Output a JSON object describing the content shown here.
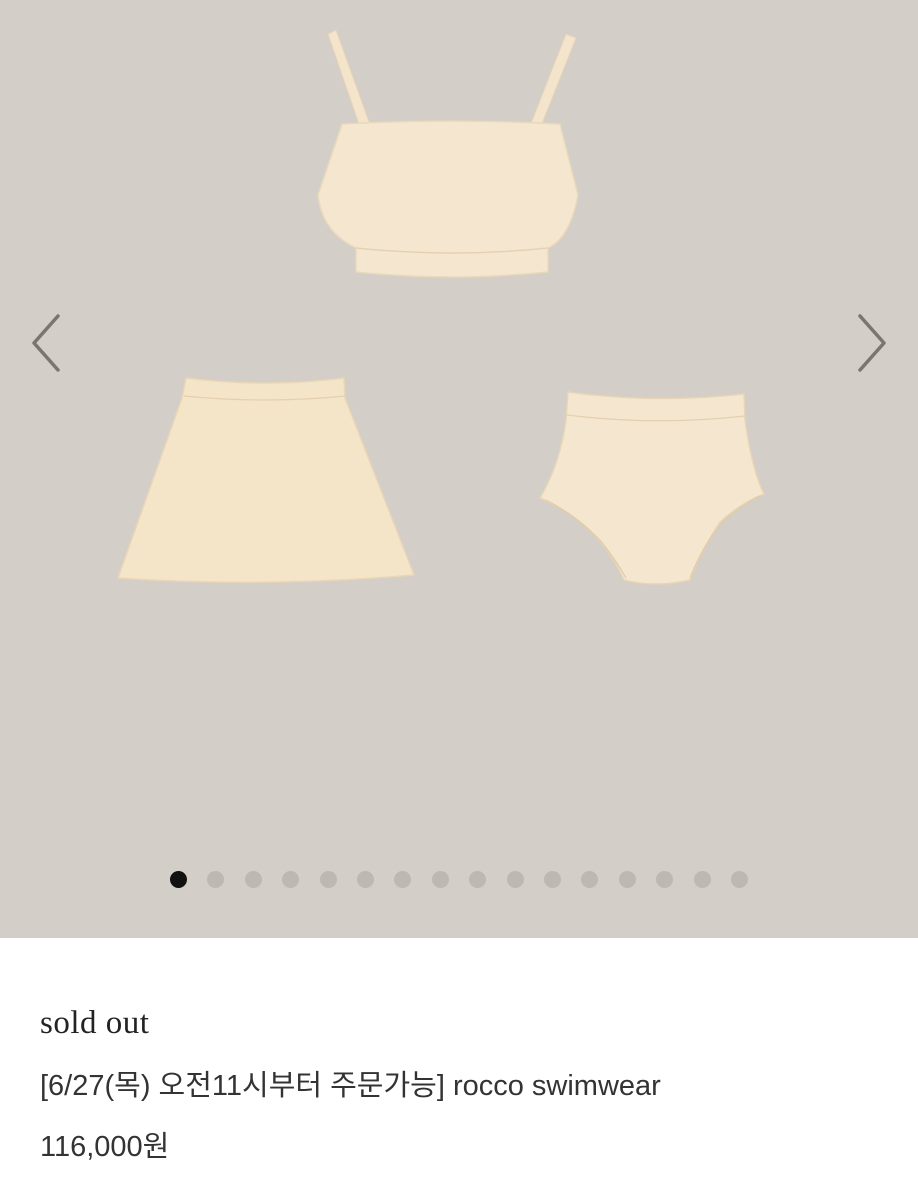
{
  "gallery": {
    "prev_icon": "chevron-left-icon",
    "next_icon": "chevron-right-icon",
    "background_color": "#d3cec7",
    "garment_color": "#f4e6cf",
    "slide_count": 16,
    "active_slide": 1
  },
  "product": {
    "status": "sold out",
    "name": "[6/27(목) 오전11시부터 주문가능] rocco swimwear",
    "price": "116,000원"
  }
}
